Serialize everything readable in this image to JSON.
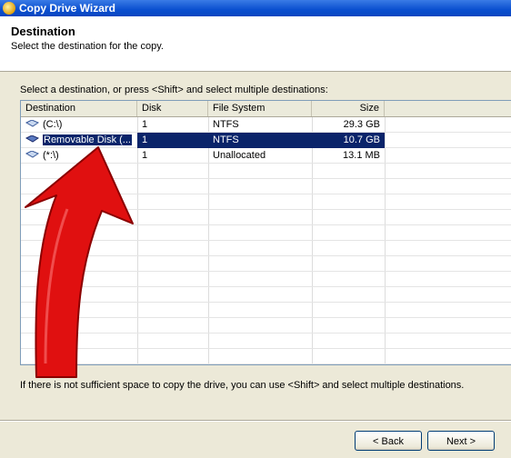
{
  "window": {
    "title": "Copy Drive Wizard"
  },
  "header": {
    "title": "Destination",
    "subtitle": "Select the destination for the copy."
  },
  "instruction": "Select a destination, or press <Shift> and select multiple destinations:",
  "table": {
    "columns": [
      "Destination",
      "Disk",
      "File System",
      "Size"
    ],
    "rows": [
      {
        "destination": "(C:\\)",
        "disk": "1",
        "file_system": "NTFS",
        "size": "29.3 GB",
        "selected": false,
        "icon": "hard-drive-icon"
      },
      {
        "destination": "Removable Disk (...",
        "disk": "1",
        "file_system": "NTFS",
        "size": "10.7 GB",
        "selected": true,
        "icon": "removable-disk-icon"
      },
      {
        "destination": "(*:\\)",
        "disk": "1",
        "file_system": "Unallocated",
        "size": "13.1 MB",
        "selected": false,
        "icon": "hard-drive-icon"
      }
    ]
  },
  "footnote": "If there is not sufficient space to copy the drive, you can use <Shift> and select multiple destinations.",
  "buttons": {
    "back": "< Back",
    "next": "Next >"
  },
  "colors": {
    "selection": "#0a246a",
    "titlebar": "#0a4fcf",
    "arrow": "#e01010"
  }
}
